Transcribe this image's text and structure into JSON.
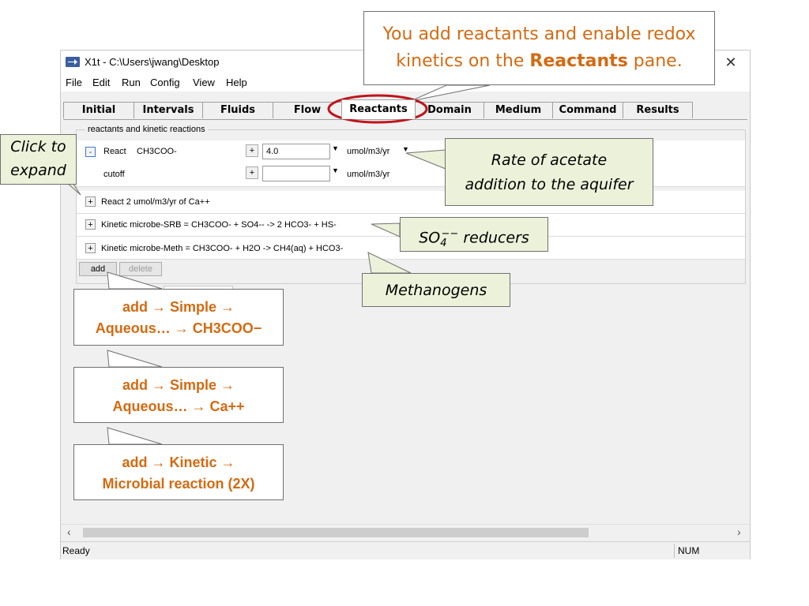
{
  "window": {
    "title": "X1t - C:\\Users\\jwang\\Desktop",
    "close_glyph": "✕",
    "icon_name": "arrow-right-icon"
  },
  "menu": [
    "File",
    "Edit",
    "Run",
    "Config",
    "View",
    "Help"
  ],
  "tabs": [
    "Initial",
    "Intervals",
    "Fluids",
    "Flow",
    "Reactants",
    "Domain",
    "Medium",
    "Command",
    "Results"
  ],
  "active_tab": "Reactants",
  "groupbox_label": "reactants and kinetic reactions",
  "rows": {
    "react_acetate": {
      "expander": "-",
      "label": "React",
      "species": "CH3COO-",
      "plus": "+",
      "value": "4.0",
      "unit": "umol/m3/yr"
    },
    "cutoff": {
      "label": "cutoff",
      "plus": "+",
      "value": "",
      "unit": "umol/m3/yr"
    },
    "react_ca": {
      "expander": "+",
      "text": "React 2 umol/m3/yr of Ca++"
    },
    "srb": {
      "expander": "+",
      "text": "Kinetic microbe-SRB = CH3COO-  + SO4--  -> 2 HCO3-  + HS-"
    },
    "meth": {
      "expander": "+",
      "text": "Kinetic microbe-Meth = CH3COO-  + H2O  -> CH4(aq)  + HCO3-"
    }
  },
  "buttons": {
    "add": "add",
    "delete": "delete"
  },
  "status": {
    "text": "Ready",
    "num": "NUM"
  },
  "callouts": {
    "top_part1": "You add reactants and enable redox",
    "top_part2": "kinetics on the ",
    "top_bold": "Reactants",
    "top_part3": " pane.",
    "click_expand_1": "Click to",
    "click_expand_2": "expand",
    "rate_1": "Rate of acetate",
    "rate_2": "addition to the aquifer",
    "so4_base": "SO",
    "so4_sub": "4",
    "so4_sup": "−−",
    "so4_rest": " reducers",
    "methanogens": "Methanogens",
    "add_simple_1a": "add → Simple →",
    "add_simple_1b": "Aqueous… → CH3COO−",
    "add_simple_2a": "add → Simple →",
    "add_simple_2b": "Aqueous… → Ca++",
    "add_kinetic_a": "add → Kinetic →",
    "add_kinetic_b": "Microbial reaction (2X)"
  },
  "colors": {
    "accent": "#d46a11",
    "highlight_ring": "#c0141c",
    "callout_fill": "#ecf2da"
  }
}
